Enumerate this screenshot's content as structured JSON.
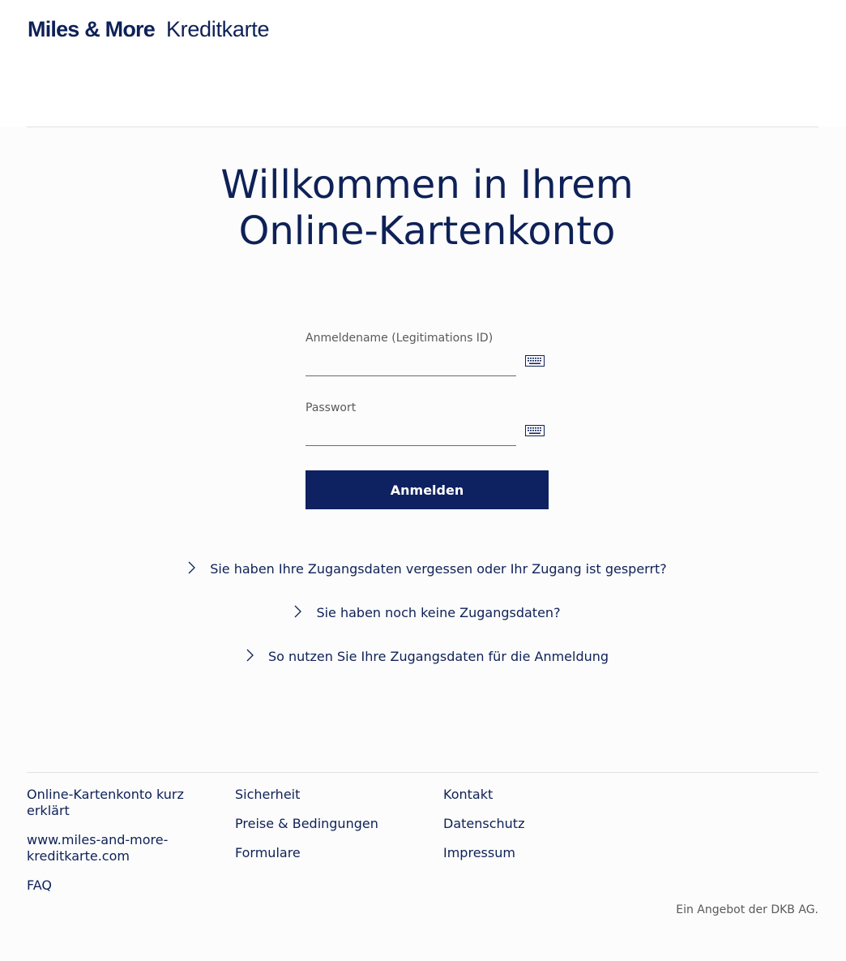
{
  "header": {
    "brand": "Miles & More",
    "product": "Kreditkarte"
  },
  "welcome": {
    "line1": "Willkommen in Ihrem",
    "line2": "Online-Kartenkonto"
  },
  "login_form": {
    "username_label": "Anmeldename (Legitimations ID)",
    "username_value": "",
    "password_label": "Passwort",
    "password_value": "",
    "submit_label": "Anmelden",
    "keyboard_icon": "keyboard-icon"
  },
  "help_links": [
    "Sie haben Ihre Zugangsdaten vergessen oder Ihr Zugang ist gesperrt?",
    "Sie haben noch keine Zugangsdaten?",
    "So nutzen Sie Ihre Zugangsdaten für die Anmeldung"
  ],
  "footer": {
    "col1": [
      "Online-Kartenkonto kurz erklärt",
      "www.miles-and-more-kreditkarte.com",
      "FAQ"
    ],
    "col2": [
      "Sicherheit",
      "Preise & Bedingungen",
      "Formulare"
    ],
    "col3": [
      "Kontakt",
      "Datenschutz",
      "Impressum"
    ],
    "provider_note": "Ein Angebot der DKB AG."
  },
  "colors": {
    "brand_navy": "#0e2160",
    "background": "#fcfcfc",
    "muted_text": "#5a5a5a"
  }
}
